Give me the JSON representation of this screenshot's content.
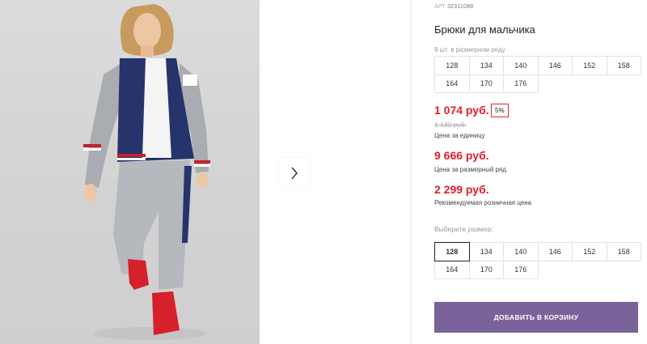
{
  "gallery": {
    "next_icon": "chevron-right-icon"
  },
  "product": {
    "art_label": "АРТ",
    "art_code": "32311088",
    "title": "Брюки для мальчика",
    "set_note": "9 шт. в размерном ряду",
    "sizes_info": [
      "128",
      "134",
      "140",
      "146",
      "152",
      "158",
      "164",
      "170",
      "176"
    ]
  },
  "pricing": {
    "unit_price": "1 074 руб.",
    "discount_badge": "5%",
    "old_price": "1 130 руб.",
    "unit_caption": "Цена за единицу",
    "set_price": "9 666 руб.",
    "set_caption": "Цена за размерный ряд",
    "retail_price": "2 299 руб.",
    "retail_caption": "Рекомендуемая розничная цена"
  },
  "size_select": {
    "label": "Выберите размер:",
    "sizes": [
      "128",
      "134",
      "140",
      "146",
      "152",
      "158",
      "164",
      "170",
      "176"
    ],
    "selected": "128"
  },
  "cart": {
    "add_label": "ДОБАВИТЬ В КОРЗИНУ"
  },
  "colors": {
    "price_red": "#e0202c",
    "button_purple": "#7a629a"
  }
}
